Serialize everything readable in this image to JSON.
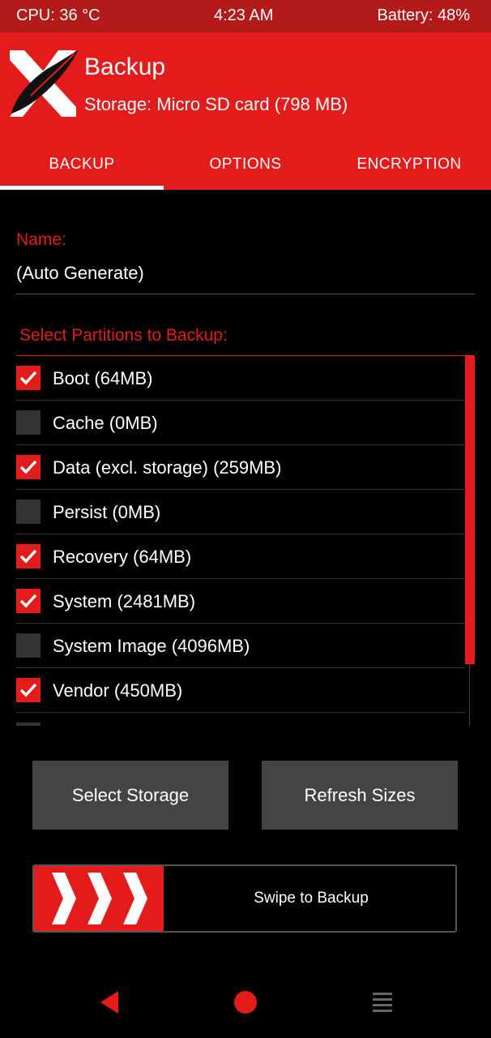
{
  "status": {
    "cpu": "CPU: 36 °C",
    "time": "4:23 AM",
    "battery": "Battery: 48%"
  },
  "header": {
    "title": "Backup",
    "storage": "Storage: Micro SD card (798 MB)"
  },
  "tabs": [
    {
      "label": "BACKUP",
      "active": true
    },
    {
      "label": "OPTIONS",
      "active": false
    },
    {
      "label": "ENCRYPTION",
      "active": false
    }
  ],
  "name_field": {
    "label": "Name:",
    "value": "(Auto Generate)"
  },
  "partitions": {
    "label": "Select Partitions to Backup:",
    "items": [
      {
        "label": "Boot (64MB)",
        "checked": true
      },
      {
        "label": "Cache (0MB)",
        "checked": false
      },
      {
        "label": "Data (excl. storage) (259MB)",
        "checked": true
      },
      {
        "label": "Persist (0MB)",
        "checked": false
      },
      {
        "label": "Recovery (64MB)",
        "checked": true
      },
      {
        "label": "System (2481MB)",
        "checked": true
      },
      {
        "label": "System Image (4096MB)",
        "checked": false
      },
      {
        "label": "Vendor (450MB)",
        "checked": true
      },
      {
        "label": "",
        "checked": false
      }
    ]
  },
  "buttons": {
    "select_storage": "Select Storage",
    "refresh_sizes": "Refresh Sizes"
  },
  "swipe": {
    "label": "Swipe to Backup"
  },
  "colors": {
    "accent": "#e31b1b",
    "statusbar": "#b31b1b",
    "button": "#444444"
  }
}
